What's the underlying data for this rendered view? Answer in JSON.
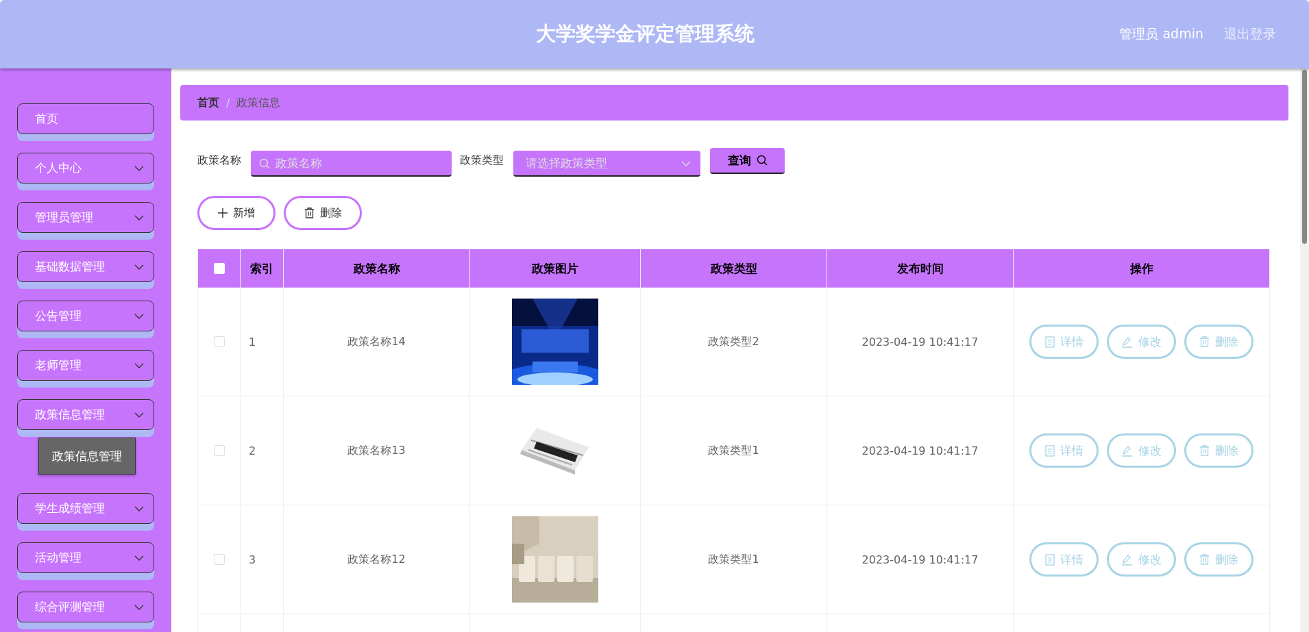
{
  "header": {
    "title": "大学奖学金评定管理系统",
    "user": "管理员 admin",
    "logout": "退出登录"
  },
  "sidebar": {
    "items": [
      {
        "label": "首页",
        "kind": "link"
      },
      {
        "label": "个人中心",
        "kind": "menu"
      },
      {
        "label": "管理员管理",
        "kind": "menu"
      },
      {
        "label": "基础数据管理",
        "kind": "menu"
      },
      {
        "label": "公告管理",
        "kind": "menu"
      },
      {
        "label": "老师管理",
        "kind": "menu"
      },
      {
        "label": "政策信息管理",
        "kind": "menu",
        "children": [
          {
            "label": "政策信息管理"
          }
        ]
      },
      {
        "label": "学生成绩管理",
        "kind": "menu"
      },
      {
        "label": "活动管理",
        "kind": "menu"
      },
      {
        "label": "综合评测管理",
        "kind": "menu"
      }
    ]
  },
  "breadcrumb": {
    "items": [
      {
        "label": "首页"
      },
      {
        "label": "政策信息"
      }
    ],
    "separator": "/"
  },
  "search": {
    "fields": [
      {
        "label": "政策名称",
        "kind": "text",
        "placeholder": "政策名称"
      },
      {
        "label": "政策类型",
        "kind": "select",
        "placeholder": "请选择政策类型"
      }
    ],
    "button": "查询"
  },
  "toolbar": [
    {
      "label": "新增",
      "kind": "add"
    },
    {
      "label": "删除",
      "kind": "delete"
    }
  ],
  "table": {
    "select_all_checked": false,
    "columns": [
      "索引",
      "政策名称",
      "政策图片",
      "政策类型",
      "发布时间",
      "操作"
    ],
    "rows": [
      {
        "checked": false,
        "index": "1",
        "name": "政策名称14",
        "type": "政策类型2",
        "time": "2023-04-19 10:41:17",
        "actions": [
          {
            "label": "详情",
            "kind": "detail"
          },
          {
            "label": "修改",
            "kind": "edit"
          },
          {
            "label": "删除",
            "kind": "delete"
          }
        ]
      },
      {
        "checked": false,
        "index": "2",
        "name": "政策名称13",
        "type": "政策类型1",
        "time": "2023-04-19 10:41:17",
        "actions": [
          {
            "label": "详情",
            "kind": "detail"
          },
          {
            "label": "修改",
            "kind": "edit"
          },
          {
            "label": "删除",
            "kind": "delete"
          }
        ]
      },
      {
        "checked": false,
        "index": "3",
        "name": "政策名称12",
        "type": "政策类型1",
        "time": "2023-04-19 10:41:17",
        "actions": [
          {
            "label": "详情",
            "kind": "detail"
          },
          {
            "label": "修改",
            "kind": "edit"
          },
          {
            "label": "删除",
            "kind": "delete"
          }
        ]
      }
    ]
  }
}
